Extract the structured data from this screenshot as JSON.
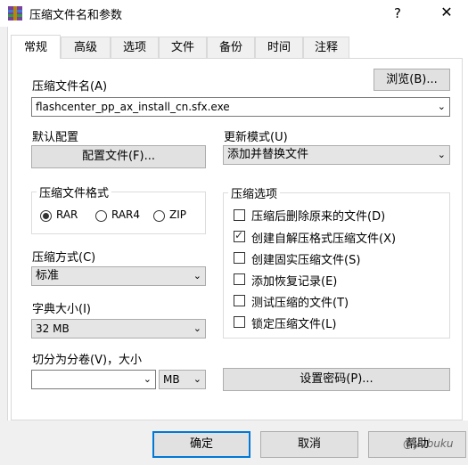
{
  "window": {
    "title": "压缩文件名和参数",
    "help_label": "?",
    "close_label": "✕",
    "icon": "winrar-icon"
  },
  "tabs": [
    "常规",
    "高级",
    "选项",
    "文件",
    "备份",
    "时间",
    "注释"
  ],
  "archive_name": {
    "label": "压缩文件名(A)",
    "value": "flashcenter_pp_ax_install_cn.sfx.exe",
    "browse_label": "浏览(B)..."
  },
  "default_profile": {
    "label": "默认配置",
    "button_label": "配置文件(F)..."
  },
  "update_mode": {
    "label": "更新模式(U)",
    "value": "添加并替换文件"
  },
  "format": {
    "title": "压缩文件格式",
    "options": [
      "RAR",
      "RAR4",
      "ZIP"
    ],
    "selected": "RAR"
  },
  "method": {
    "label": "压缩方式(C)",
    "value": "标准"
  },
  "dictionary": {
    "label": "字典大小(I)",
    "value": "32 MB"
  },
  "split": {
    "label": "切分为分卷(V)，大小",
    "value": "",
    "unit": "MB"
  },
  "options": {
    "title": "压缩选项",
    "items": [
      {
        "label": "压缩后删除原来的文件(D)",
        "checked": false
      },
      {
        "label": "创建自解压格式压缩文件(X)",
        "checked": true
      },
      {
        "label": "创建固实压缩文件(S)",
        "checked": false
      },
      {
        "label": "添加恢复记录(E)",
        "checked": false
      },
      {
        "label": "测试压缩的文件(T)",
        "checked": false
      },
      {
        "label": "锁定压缩文件(L)",
        "checked": false
      }
    ]
  },
  "password_button": "设置密码(P)...",
  "footer": {
    "ok": "确定",
    "cancel": "取消",
    "help": "帮助"
  },
  "watermark": "@yubuku"
}
